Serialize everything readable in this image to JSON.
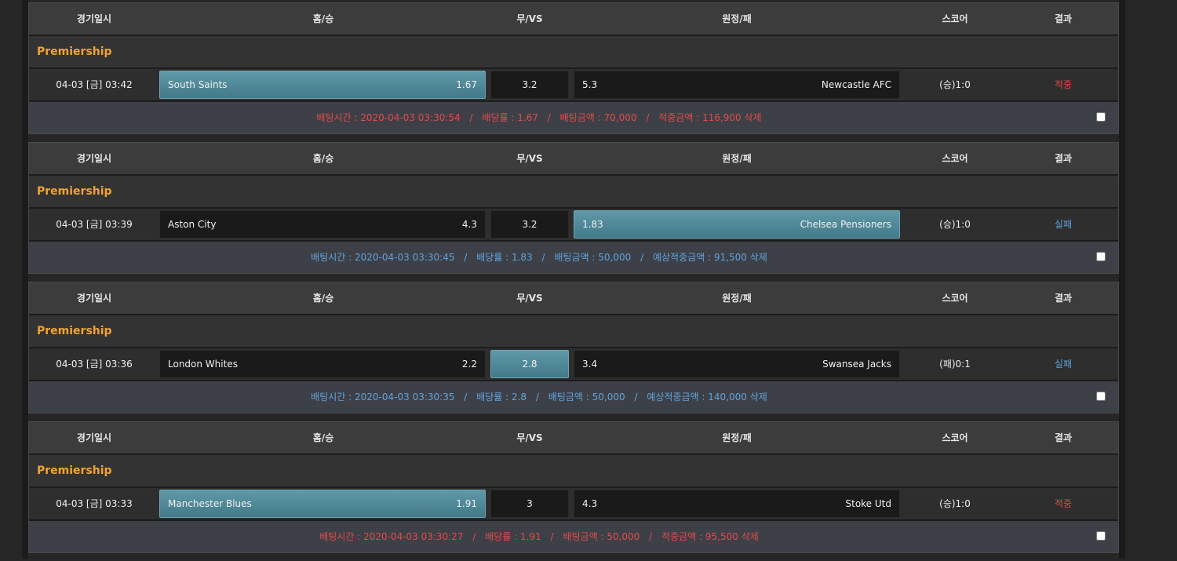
{
  "headers": {
    "date": "경기일시",
    "home": "홈/승",
    "draw": "무/VS",
    "away": "원정/패",
    "score": "스코어",
    "result": "결과"
  },
  "labels": {
    "bet_time": "배팅시간 :",
    "odds": "배당률 :",
    "amount": "배팅금액 :",
    "delete": "삭제",
    "separator": "/"
  },
  "colors": {
    "win": "#e24a4a",
    "lose": "#5ea3dd",
    "league": "#f0a333",
    "selected": "#4f8a99"
  },
  "bets": [
    {
      "league": "Premiership",
      "date": "04-03 [금] 03:42",
      "home_team": "South Saints",
      "home_odds": "1.67",
      "draw_odds": "3.2",
      "away_odds": "5.3",
      "away_team": "Newcastle AFC",
      "selected": "home",
      "score": "(승)1:0",
      "result": "적중",
      "status": "win",
      "bet_time": "2020-04-03 03:30:54",
      "bet_odds": "1.67",
      "bet_amount": "70,000",
      "payout_label": "적중금액 :",
      "payout": "116,900"
    },
    {
      "league": "Premiership",
      "date": "04-03 [금] 03:39",
      "home_team": "Aston City",
      "home_odds": "4.3",
      "draw_odds": "3.2",
      "away_odds": "1.83",
      "away_team": "Chelsea Pensioners",
      "selected": "away",
      "score": "(승)1:0",
      "result": "실패",
      "status": "lose",
      "bet_time": "2020-04-03 03:30:45",
      "bet_odds": "1.83",
      "bet_amount": "50,000",
      "payout_label": "예상적중금액 :",
      "payout": "91,500"
    },
    {
      "league": "Premiership",
      "date": "04-03 [금] 03:36",
      "home_team": "London Whites",
      "home_odds": "2.2",
      "draw_odds": "2.8",
      "away_odds": "3.4",
      "away_team": "Swansea Jacks",
      "selected": "draw",
      "score": "(패)0:1",
      "result": "실패",
      "status": "lose",
      "bet_time": "2020-04-03 03:30:35",
      "bet_odds": "2.8",
      "bet_amount": "50,000",
      "payout_label": "예상적중금액 :",
      "payout": "140,000"
    },
    {
      "league": "Premiership",
      "date": "04-03 [금] 03:33",
      "home_team": "Manchester Blues",
      "home_odds": "1.91",
      "draw_odds": "3",
      "away_odds": "4.3",
      "away_team": "Stoke Utd",
      "selected": "home",
      "score": "(승)1:0",
      "result": "적중",
      "status": "win",
      "bet_time": "2020-04-03 03:30:27",
      "bet_odds": "1.91",
      "bet_amount": "50,000",
      "payout_label": "적중금액 :",
      "payout": "95,500"
    }
  ]
}
